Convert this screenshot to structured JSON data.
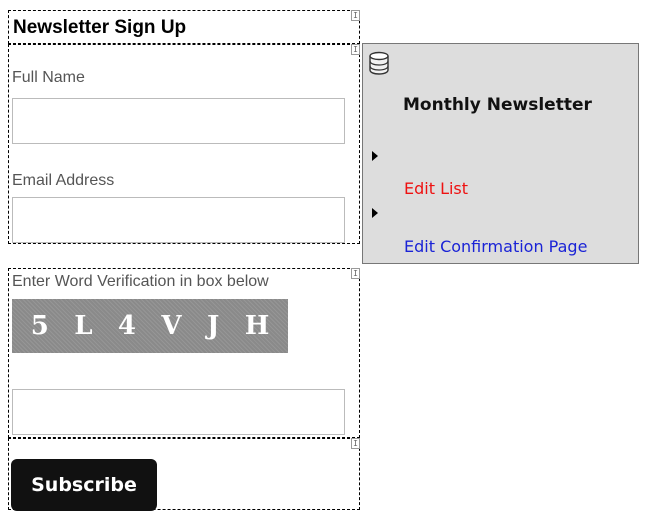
{
  "form": {
    "title": "Newsletter Sign Up",
    "full_name_label": "Full Name",
    "full_name_value": "",
    "email_label": "Email Address",
    "email_value": "",
    "verification_label": "Enter Word Verification in box below",
    "captcha_chars": [
      "5",
      "L",
      "4",
      "V",
      "J",
      "H"
    ],
    "verification_value": "",
    "subscribe_label": "Subscribe"
  },
  "panel": {
    "icon": "database-icon",
    "title": "Monthly Newsletter",
    "edit_list_label": "Edit List",
    "edit_confirmation_label": "Edit Confirmation Page"
  },
  "colors": {
    "edit_list": "#ee1111",
    "edit_confirmation": "#1a23d6",
    "panel_background": "#dddddd",
    "button_background": "#111111"
  }
}
